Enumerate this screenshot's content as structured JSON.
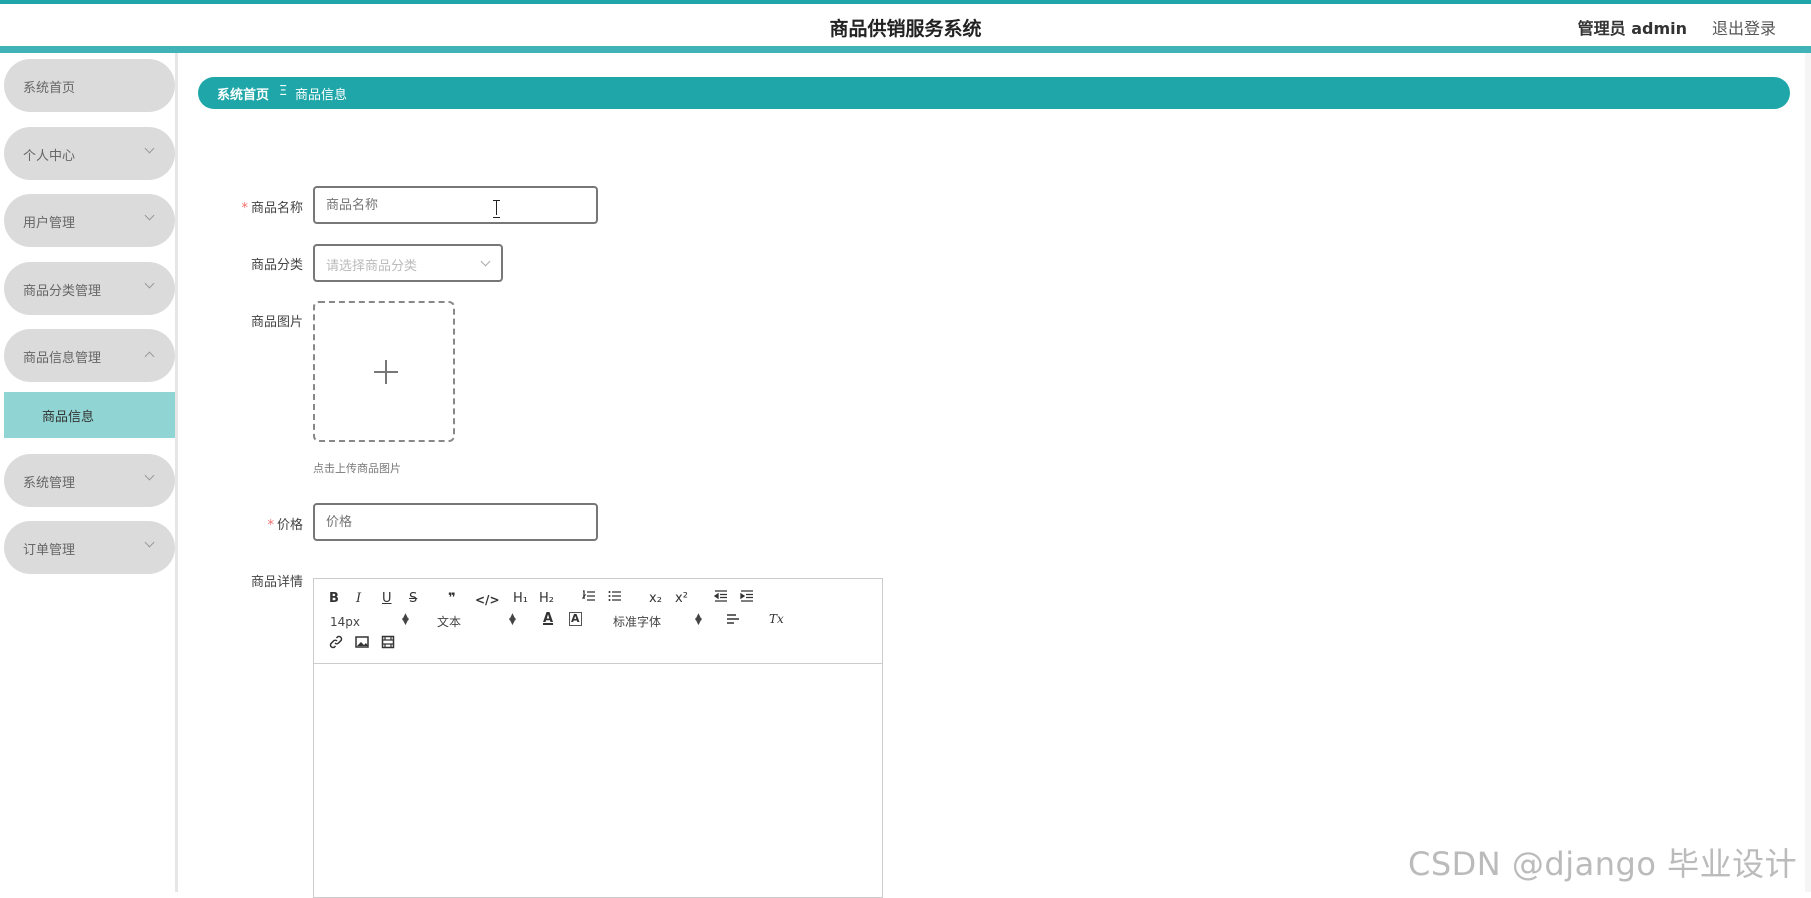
{
  "header": {
    "title": "商品供销服务系统",
    "user": "管理员 admin",
    "logout": "退出登录"
  },
  "sidebar": {
    "items": [
      {
        "label": "系统首页"
      },
      {
        "label": "个人中心"
      },
      {
        "label": "用户管理"
      },
      {
        "label": "商品分类管理"
      },
      {
        "label": "商品信息管理"
      },
      {
        "label": "系统管理"
      },
      {
        "label": "订单管理"
      }
    ],
    "active_sub": "商品信息"
  },
  "breadcrumb": {
    "home": "系统首页",
    "separator": "Ξ",
    "current": "商品信息"
  },
  "form": {
    "required_mark": "*",
    "name_label": "商品名称",
    "name_placeholder": "商品名称",
    "category_label": "商品分类",
    "category_placeholder": "请选择商品分类",
    "image_label": "商品图片",
    "image_tip": "点击上传商品图片",
    "price_label": "价格",
    "price_placeholder": "价格",
    "detail_label": "商品详情"
  },
  "editor": {
    "bold": "B",
    "italic": "I",
    "underline": "U",
    "strike": "S",
    "blockquote": "❞",
    "code": "</>",
    "h1": "H₁",
    "h2": "H₂",
    "subscript": "x₂",
    "superscript": "x²",
    "font_size": "14px",
    "text_style": "文本",
    "font_family": "标准字体",
    "clear": "Tx"
  },
  "watermark": "CSDN @django 毕业设计"
}
